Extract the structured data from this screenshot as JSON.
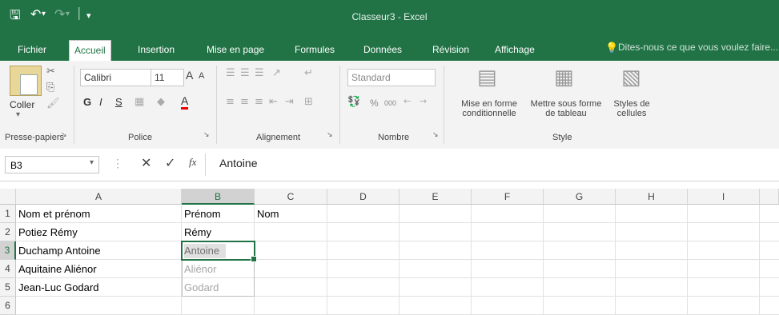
{
  "app": {
    "title": "Classeur3 - Excel",
    "accent": "#217346"
  },
  "qat": {
    "save_icon": "floppy-save-icon",
    "undo_icon": "undo-icon",
    "redo_icon": "redo-icon",
    "customize_icon": "customize-qat-icon"
  },
  "tabs": [
    {
      "label": "Fichier"
    },
    {
      "label": "Accueil",
      "active": true
    },
    {
      "label": "Insertion"
    },
    {
      "label": "Mise en page"
    },
    {
      "label": "Formules"
    },
    {
      "label": "Données"
    },
    {
      "label": "Révision"
    },
    {
      "label": "Affichage"
    }
  ],
  "tellme": {
    "label": "Dites-nous ce que vous voulez faire..."
  },
  "ribbon": {
    "clipboard": {
      "paste_label": "Coller",
      "group_label": "Presse-papiers"
    },
    "font": {
      "name": "Calibri",
      "size": "11",
      "bold": "G",
      "italic": "I",
      "underline": "S",
      "grow": "A",
      "shrink": "A",
      "color_letter": "A",
      "group_label": "Police"
    },
    "alignment": {
      "group_label": "Alignement"
    },
    "number": {
      "format": "Standard",
      "percent": "%",
      "thousands": "000",
      "group_label": "Nombre"
    },
    "styles": {
      "conditional_line1": "Mise en forme",
      "conditional_line2": "conditionnelle",
      "table_line1": "Mettre sous forme",
      "table_line2": "de tableau",
      "cell_line1": "Styles de",
      "cell_line2": "cellules",
      "group_label": "Style"
    }
  },
  "formula_bar": {
    "name_box": "B3",
    "fx": "fx",
    "value": "Antoine"
  },
  "sheet": {
    "columns": [
      "A",
      "B",
      "C",
      "D",
      "E",
      "F",
      "G",
      "H",
      "I"
    ],
    "selected_column": "B",
    "selected_row": "3",
    "rows": [
      {
        "num": "1",
        "A": "Nom et prénom",
        "B": "Prénom",
        "C": "Nom"
      },
      {
        "num": "2",
        "A": "Potiez Rémy",
        "B": "Rémy",
        "C": ""
      },
      {
        "num": "3",
        "A": "Duchamp Antoine",
        "B": "Antoine",
        "C": ""
      },
      {
        "num": "4",
        "A": "Aquitaine Aliénor",
        "B": "Aliénor",
        "C": ""
      },
      {
        "num": "5",
        "A": "Jean-Luc Godard",
        "B": "Godard",
        "C": ""
      },
      {
        "num": "6",
        "A": "",
        "B": "",
        "C": ""
      }
    ],
    "flash_fill_preview_rows": [
      "4",
      "5"
    ]
  }
}
